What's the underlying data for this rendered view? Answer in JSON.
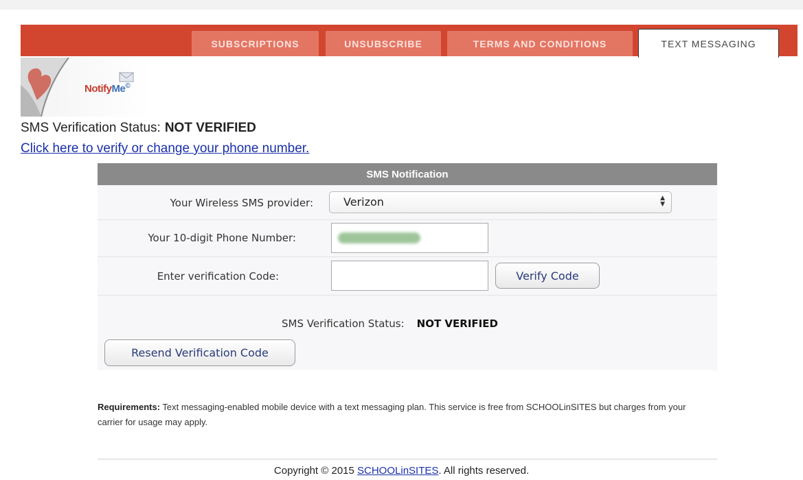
{
  "tabs": [
    {
      "label": "SUBSCRIPTIONS",
      "active": false
    },
    {
      "label": "UNSUBSCRIBE",
      "active": false
    },
    {
      "label": "TERMS AND CONDITIONS",
      "active": false
    },
    {
      "label": "TEXT MESSAGING",
      "active": true
    }
  ],
  "logo": {
    "part1": "Notify",
    "part2": "Me",
    "mark": "©"
  },
  "status": {
    "label": "SMS Verification Status:",
    "value": "NOT VERIFIED"
  },
  "verify_link": "Click here to verify or change your phone number.",
  "panel": {
    "title": "SMS Notification",
    "provider_label": "Your Wireless SMS provider:",
    "provider_value": "Verizon",
    "phone_label": "Your 10-digit Phone Number:",
    "code_label": "Enter verification Code:",
    "verify_button": "Verify Code",
    "status_label": "SMS Verification Status:",
    "status_value": "NOT VERIFIED",
    "resend_button": "Resend Verification Code"
  },
  "requirements": {
    "label": "Requirements:",
    "text": " Text messaging-enabled mobile device with a text messaging plan. This service is free from SCHOOLinSITES but charges from your carrier for usage may apply."
  },
  "footer": {
    "prefix": "Copyright © 2015 ",
    "link": "SCHOOLinSITES",
    "suffix": ". All rights reserved."
  },
  "colors": {
    "header_red": "#d24630",
    "tab_inactive": "#e37563",
    "panel_head": "#8a8a8a",
    "link": "#1a2fa8"
  }
}
